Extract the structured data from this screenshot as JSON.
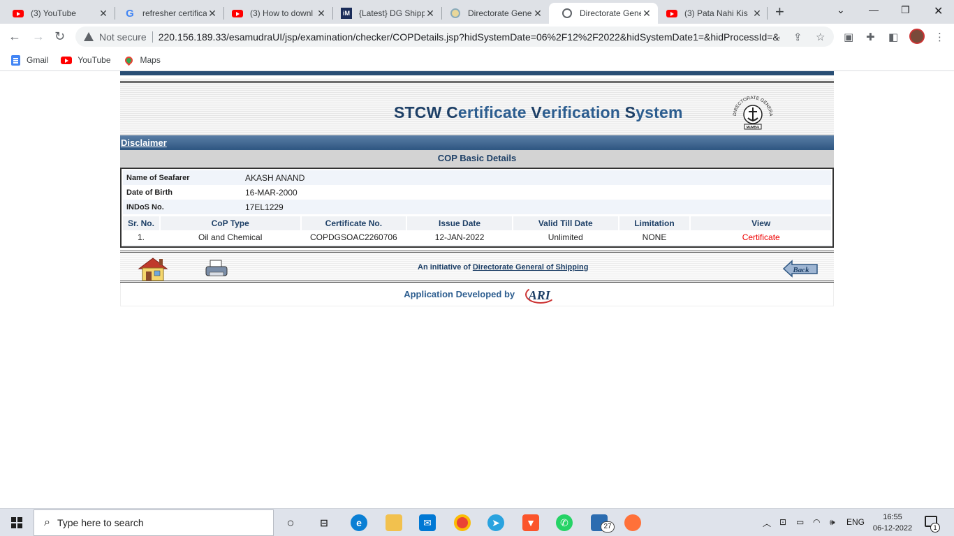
{
  "browser": {
    "tabs": [
      {
        "title": "(3) YouTube",
        "icon": "youtube-icon",
        "active": false
      },
      {
        "title": "refresher certifica",
        "icon": "google-icon",
        "active": false
      },
      {
        "title": "(3) How to downl",
        "icon": "youtube-icon",
        "active": false
      },
      {
        "title": "{Latest} DG Shipp",
        "icon": "im-icon",
        "active": false
      },
      {
        "title": "Directorate Gene",
        "icon": "dg-shipping-icon",
        "active": false
      },
      {
        "title": "Directorate Gene",
        "icon": "globe-icon",
        "active": true
      },
      {
        "title": "(3) Pata Nahi Kis",
        "icon": "youtube-icon",
        "active": false
      }
    ],
    "address": {
      "security_label": "Not secure",
      "url": "220.156.189.33/esamudraUI/jsp/examination/checker/COPDetails.jsp?hidSystemDate=06%2F12%2F2022&hidSystemDate1=&hidProcessId=&c..."
    },
    "bookmarks": [
      {
        "label": "Gmail",
        "icon": "gmail-icon"
      },
      {
        "label": "YouTube",
        "icon": "youtube-icon"
      },
      {
        "label": "Maps",
        "icon": "maps-icon"
      }
    ]
  },
  "page": {
    "title_parts": [
      {
        "cap": "STCW ",
        "rest": ""
      },
      {
        "cap": "C",
        "rest": "ertificate "
      },
      {
        "cap": "V",
        "rest": "erification "
      },
      {
        "cap": "S",
        "rest": "ystem"
      }
    ],
    "seal_text": "DIRECTORATE GENERAL OF SHIPPING",
    "seal_sub": "MUMBAI",
    "disclaimer_label": "Disclaimer",
    "section_title": "COP Basic Details",
    "details": [
      {
        "label": "Name of Seafarer",
        "value": "AKASH ANAND"
      },
      {
        "label": "Date of Birth",
        "value": "16-MAR-2000"
      },
      {
        "label": "INDoS No.",
        "value": "17EL1229"
      }
    ],
    "table": {
      "columns": [
        "Sr. No.",
        "CoP Type",
        "Certificate No.",
        "Issue Date",
        "Valid Till Date",
        "Limitation",
        "View"
      ],
      "rows": [
        [
          "1.",
          "Oil and Chemical",
          "COPDGSOAC2260706",
          "12-JAN-2022",
          "Unlimited",
          "NONE",
          "Certificate"
        ]
      ]
    },
    "footer": {
      "initiative_prefix": "An initiative of",
      "initiative_link": "Directorate General of Shipping",
      "back_label": "Back",
      "developed_by": "Application Developed by",
      "developer_logo": "ARI"
    }
  },
  "taskbar": {
    "search_placeholder": "Type here to search",
    "language": "ENG",
    "time": "16:55",
    "date": "06-12-2022",
    "badge_count": "27",
    "notification_count": "1"
  }
}
